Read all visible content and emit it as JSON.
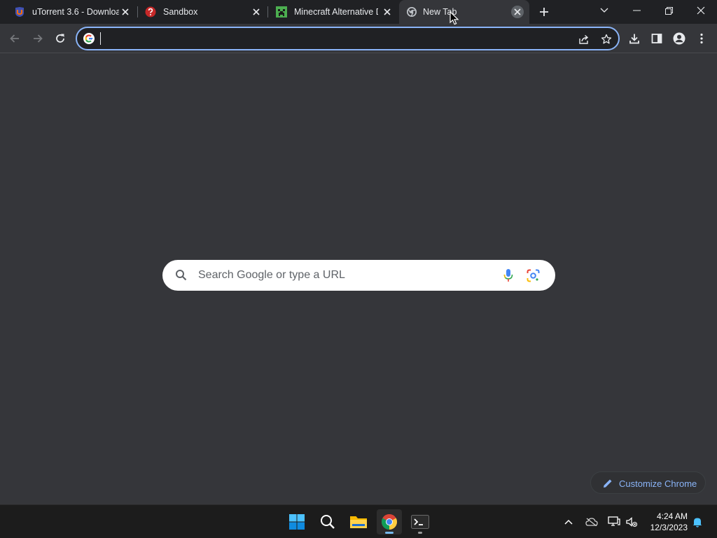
{
  "browser": {
    "tabs": [
      {
        "title": "uTorrent 3.6 - Downloa",
        "favicon": "utorrent-icon",
        "active": false
      },
      {
        "title": "Sandbox",
        "favicon": "question-icon",
        "active": false
      },
      {
        "title": "Minecraft Alternative D",
        "favicon": "minecraft-icon",
        "active": false
      },
      {
        "title": "New Tab",
        "favicon": "chrome-icon",
        "active": true
      }
    ],
    "omnibox": {
      "value": "",
      "placeholder": ""
    }
  },
  "page": {
    "search_placeholder": "Search Google or type a URL",
    "customize_label": "Customize Chrome"
  },
  "taskbar": {
    "time": "4:24 AM",
    "date": "12/3/2023"
  },
  "colors": {
    "frame": "#202124",
    "toolbar": "#35363a",
    "accent": "#8ab4f8",
    "taskbar": "#1c1c1c"
  }
}
